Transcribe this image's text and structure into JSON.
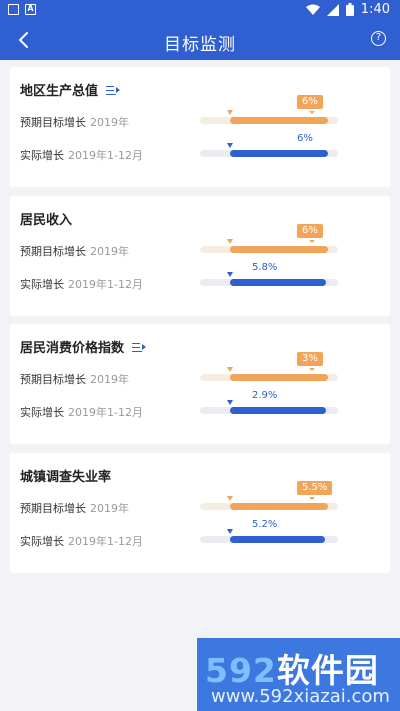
{
  "status_bar": {
    "time": "1:40",
    "icons": [
      "image-icon",
      "a-box-icon",
      "wifi-icon",
      "signal-icon",
      "battery-icon"
    ]
  },
  "header": {
    "title": "目标监测",
    "back_icon": "chevron-left-icon",
    "help_label": "?"
  },
  "cards": [
    {
      "title": "地区生产总值",
      "has_list_icon": true,
      "target_label": "预期目标增长",
      "target_period": "2019年",
      "target_value": "6%",
      "actual_label": "实际增长",
      "actual_period": "2019年1-12月",
      "actual_value": "6%",
      "target_fill": 0.78,
      "actual_fill": 0.78
    },
    {
      "title": "居民收入",
      "has_list_icon": false,
      "target_label": "预期目标增长",
      "target_period": "2019年",
      "target_value": "6%",
      "actual_label": "实际增长",
      "actual_period": "2019年1-12月",
      "actual_value": "5.8%",
      "target_fill": 0.78,
      "actual_fill": 0.77
    },
    {
      "title": "居民消费价格指数",
      "has_list_icon": true,
      "target_label": "预期目标增长",
      "target_period": "2019年",
      "target_value": "3%",
      "actual_label": "实际增长",
      "actual_period": "2019年1-12月",
      "actual_value": "2.9%",
      "target_fill": 0.78,
      "actual_fill": 0.77
    },
    {
      "title": "城镇调查失业率",
      "has_list_icon": false,
      "target_label": "预期目标增长",
      "target_period": "2019年",
      "target_value": "5.5%",
      "actual_label": "实际增长",
      "actual_period": "2019年1-12月",
      "actual_value": "5.2%",
      "target_fill": 0.78,
      "actual_fill": 0.76
    }
  ],
  "watermark": {
    "num": "592",
    "text": "软件园",
    "url": "www.592xiazai.com"
  },
  "colors": {
    "primary": "#2f5fd0",
    "target": "#f0a55a",
    "background": "#f2f2f7"
  }
}
